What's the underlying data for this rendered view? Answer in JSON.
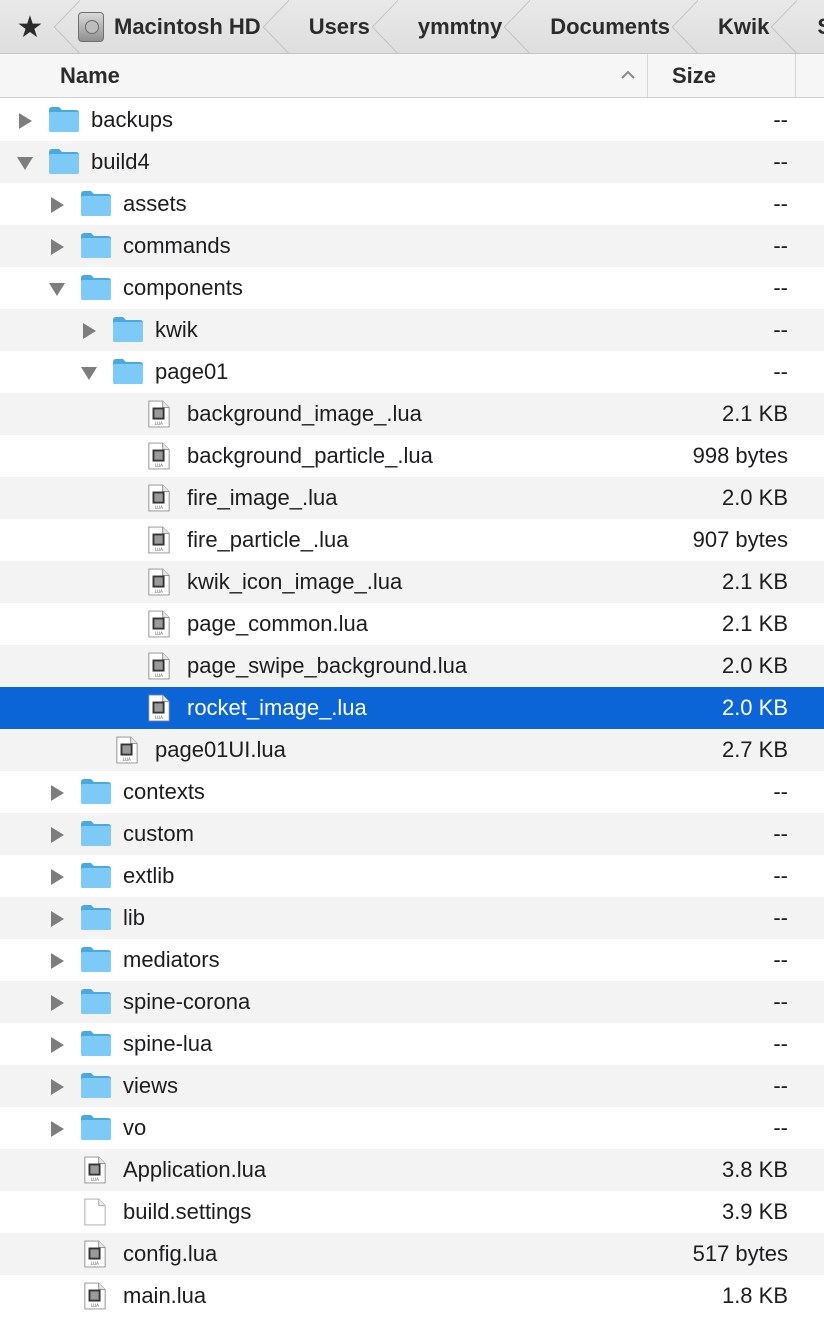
{
  "pathbar": {
    "crumbs": [
      "Macintosh HD",
      "Users",
      "ymmtny",
      "Documents",
      "Kwik",
      "Sp"
    ]
  },
  "columns": {
    "name": "Name",
    "size": "Size"
  },
  "rows": [
    {
      "name": "backups",
      "size": "--",
      "depth": 0,
      "kind": "folder",
      "expand": "collapsed"
    },
    {
      "name": "build4",
      "size": "--",
      "depth": 0,
      "kind": "folder",
      "expand": "expanded"
    },
    {
      "name": "assets",
      "size": "--",
      "depth": 1,
      "kind": "folder",
      "expand": "collapsed"
    },
    {
      "name": "commands",
      "size": "--",
      "depth": 1,
      "kind": "folder",
      "expand": "collapsed"
    },
    {
      "name": "components",
      "size": "--",
      "depth": 1,
      "kind": "folder",
      "expand": "expanded"
    },
    {
      "name": "kwik",
      "size": "--",
      "depth": 2,
      "kind": "folder",
      "expand": "collapsed"
    },
    {
      "name": "page01",
      "size": "--",
      "depth": 2,
      "kind": "folder",
      "expand": "expanded"
    },
    {
      "name": "background_image_.lua",
      "size": "2.1 KB",
      "depth": 3,
      "kind": "lua",
      "expand": "none"
    },
    {
      "name": "background_particle_.lua",
      "size": "998 bytes",
      "depth": 3,
      "kind": "lua",
      "expand": "none"
    },
    {
      "name": "fire_image_.lua",
      "size": "2.0 KB",
      "depth": 3,
      "kind": "lua",
      "expand": "none"
    },
    {
      "name": "fire_particle_.lua",
      "size": "907 bytes",
      "depth": 3,
      "kind": "lua",
      "expand": "none"
    },
    {
      "name": "kwik_icon_image_.lua",
      "size": "2.1 KB",
      "depth": 3,
      "kind": "lua",
      "expand": "none"
    },
    {
      "name": "page_common.lua",
      "size": "2.1 KB",
      "depth": 3,
      "kind": "lua",
      "expand": "none"
    },
    {
      "name": "page_swipe_background.lua",
      "size": "2.0 KB",
      "depth": 3,
      "kind": "lua",
      "expand": "none"
    },
    {
      "name": "rocket_image_.lua",
      "size": "2.0 KB",
      "depth": 3,
      "kind": "lua",
      "expand": "none",
      "selected": true
    },
    {
      "name": "page01UI.lua",
      "size": "2.7 KB",
      "depth": 2,
      "kind": "lua",
      "expand": "none"
    },
    {
      "name": "contexts",
      "size": "--",
      "depth": 1,
      "kind": "folder",
      "expand": "collapsed"
    },
    {
      "name": "custom",
      "size": "--",
      "depth": 1,
      "kind": "folder",
      "expand": "collapsed"
    },
    {
      "name": "extlib",
      "size": "--",
      "depth": 1,
      "kind": "folder",
      "expand": "collapsed"
    },
    {
      "name": "lib",
      "size": "--",
      "depth": 1,
      "kind": "folder",
      "expand": "collapsed"
    },
    {
      "name": "mediators",
      "size": "--",
      "depth": 1,
      "kind": "folder",
      "expand": "collapsed"
    },
    {
      "name": "spine-corona",
      "size": "--",
      "depth": 1,
      "kind": "folder",
      "expand": "collapsed"
    },
    {
      "name": "spine-lua",
      "size": "--",
      "depth": 1,
      "kind": "folder",
      "expand": "collapsed"
    },
    {
      "name": "views",
      "size": "--",
      "depth": 1,
      "kind": "folder",
      "expand": "collapsed"
    },
    {
      "name": "vo",
      "size": "--",
      "depth": 1,
      "kind": "folder",
      "expand": "collapsed"
    },
    {
      "name": "Application.lua",
      "size": "3.8 KB",
      "depth": 1,
      "kind": "lua",
      "expand": "none"
    },
    {
      "name": "build.settings",
      "size": "3.9 KB",
      "depth": 1,
      "kind": "doc",
      "expand": "none"
    },
    {
      "name": "config.lua",
      "size": "517 bytes",
      "depth": 1,
      "kind": "lua",
      "expand": "none"
    },
    {
      "name": "main.lua",
      "size": "1.8 KB",
      "depth": 1,
      "kind": "lua",
      "expand": "none"
    }
  ],
  "colors": {
    "selection": "#0b65d6",
    "folder": "#62bdf0",
    "stripe": "#f3f3f3"
  }
}
